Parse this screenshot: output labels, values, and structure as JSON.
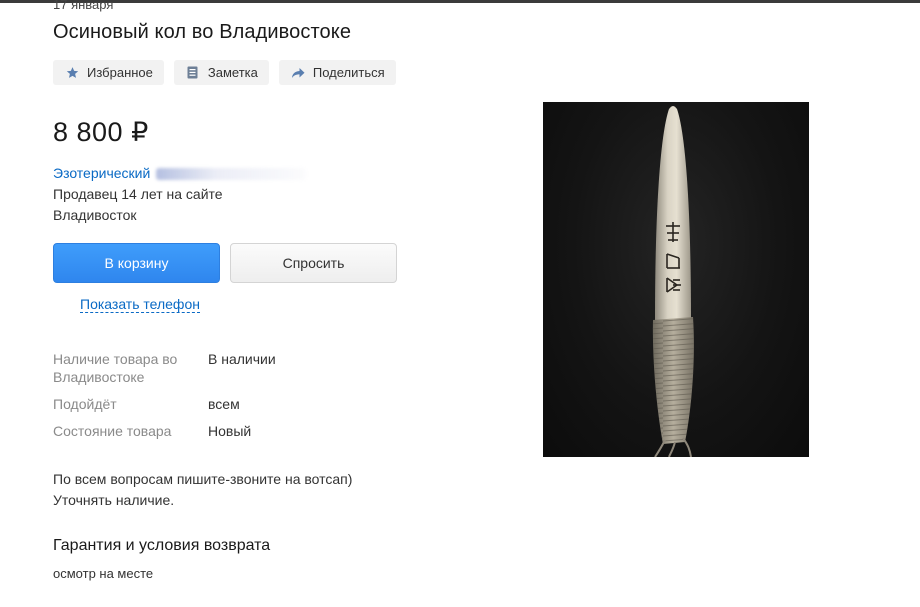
{
  "listing": {
    "date": "17 января",
    "title": "Осиновый кол во Владивостоке",
    "price": "8 800 ₽"
  },
  "actions": [
    {
      "label": "Избранное",
      "icon": "star-icon"
    },
    {
      "label": "Заметка",
      "icon": "note-icon"
    },
    {
      "label": "Поделиться",
      "icon": "share-icon"
    }
  ],
  "seller": {
    "name": "Эзотерический",
    "since": "Продавец 14 лет на сайте",
    "city": "Владивосток"
  },
  "buttons": {
    "cart": "В корзину",
    "ask": "Спросить",
    "phone": "Показать телефон"
  },
  "params": [
    {
      "key": "Наличие товара во Владивостоке",
      "value": "В наличии"
    },
    {
      "key": "Подойдёт",
      "value": "всем"
    },
    {
      "key": "Состояние товара",
      "value": "Новый"
    }
  ],
  "description": {
    "line1": "По всем вопросам пишите-звоните на вотсап)",
    "line2": "Уточнять наличие."
  },
  "guarantee": {
    "title": "Гарантия и условия возврата",
    "text": "осмотр на месте"
  },
  "colors": {
    "accent_blue": "#0a6ac5",
    "cart_button": "#3a95f7",
    "muted_label": "#8a8a8a"
  }
}
